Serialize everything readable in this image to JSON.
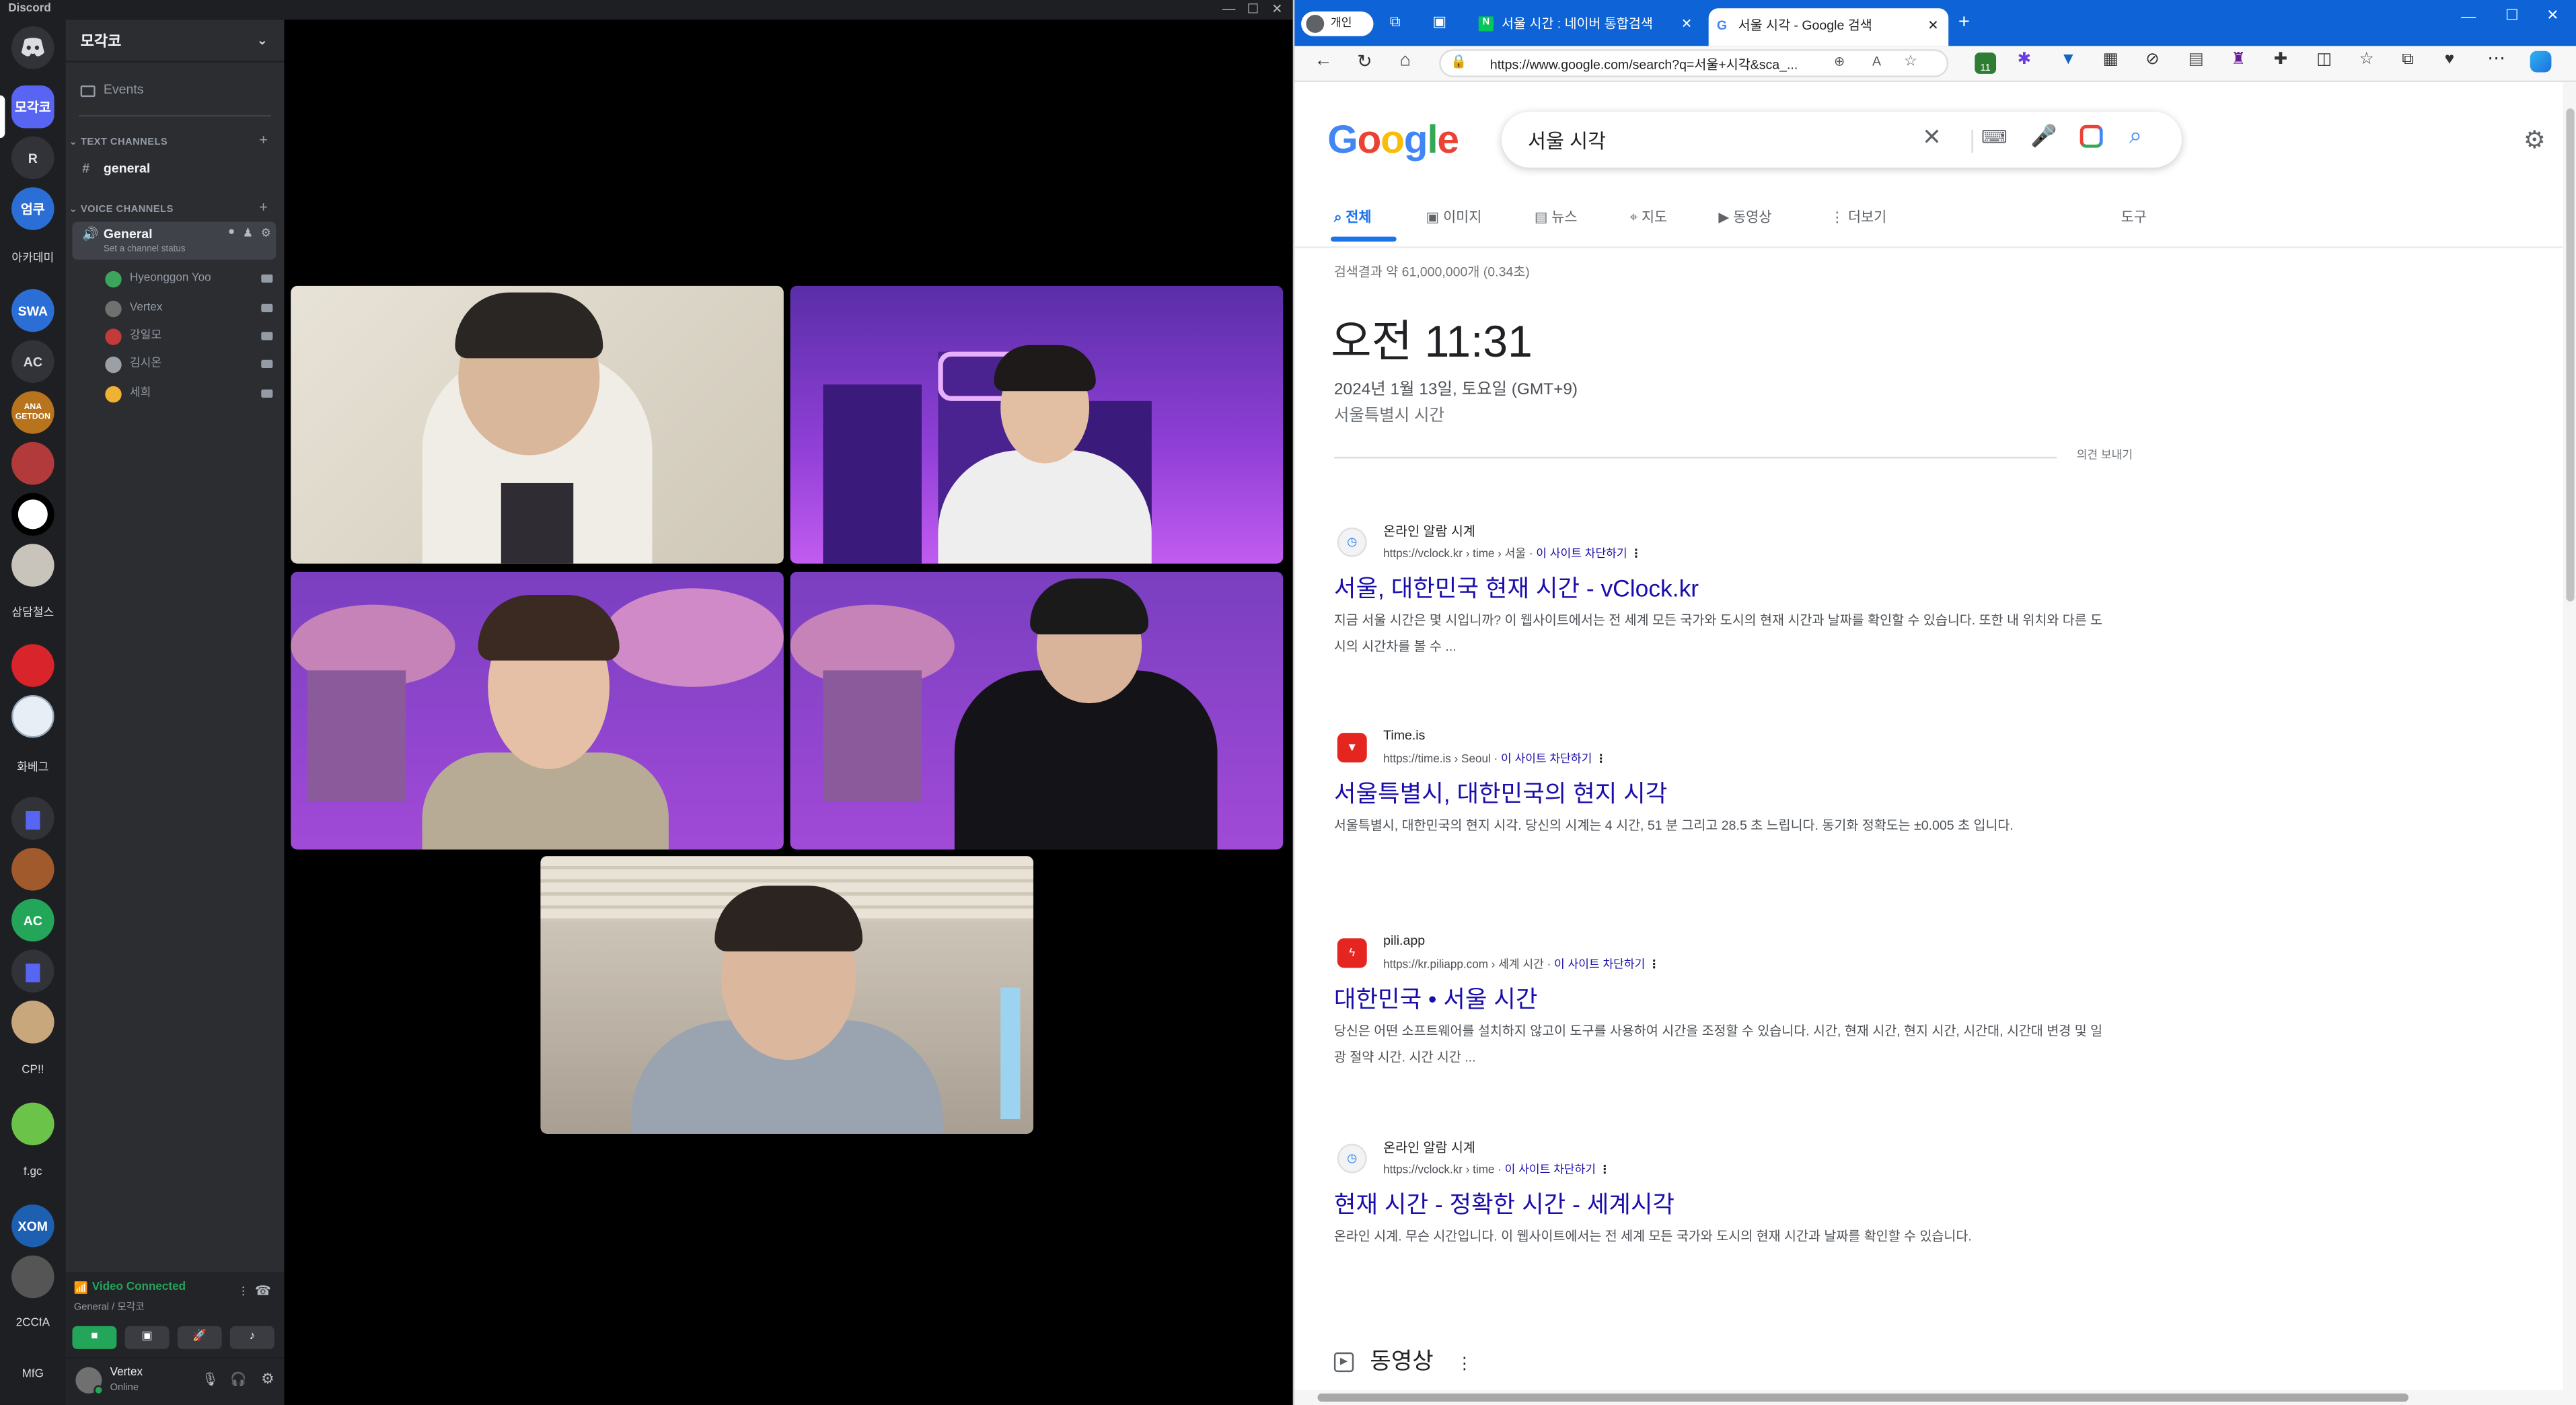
{
  "discord": {
    "app_title": "Discord",
    "server_name": "모각코",
    "events_label": "Events",
    "text_channels_label": "TEXT CHANNELS",
    "general_text": "general",
    "voice_channels_label": "VOICE CHANNELS",
    "voice_channel": "General",
    "channel_status": "Set a channel status",
    "voice_users": [
      "Hyeonggon Yoo",
      "Vertex",
      "강일모",
      "김시온",
      "세희"
    ],
    "rail_servers": [
      "모각코",
      "R",
      "엄쿠",
      "아카데미",
      "SWA",
      "AC",
      "ANA GETDON",
      "",
      "",
      "",
      "삼담철스",
      "",
      "",
      "화베그",
      "",
      "",
      "AC",
      "",
      "",
      "CP!!",
      "",
      "f.gc",
      "XOM",
      "",
      "2CCfA",
      "MfG"
    ],
    "video_connected": "Video Connected",
    "voice_path": "General / 모각코",
    "user_name": "Vertex",
    "user_status": "Online"
  },
  "browser": {
    "profile_label": "개인",
    "tabs": [
      {
        "label": "서울 시간 : 네이버 통합검색",
        "active": false
      },
      {
        "label": "서울 시각 - Google 검색",
        "active": true
      }
    ],
    "url": "https://www.google.com/search?q=서울+시각&sca_...",
    "extension_badge": "11"
  },
  "google": {
    "logo": "Google",
    "query": "서울 시각",
    "tabs": [
      "전체",
      "이미지",
      "뉴스",
      "지도",
      "동영상",
      "더보기"
    ],
    "tools": "도구",
    "result_stats": "검색결과 약 61,000,000개 (0.34초)",
    "time": "오전 11:31",
    "date": "2024년 1월 13일, 토요일 (GMT+9)",
    "location": "서울특별시 시간",
    "feedback": "의견 보내기",
    "results": [
      {
        "site": "온라인 알람 시계",
        "url": "https://vclock.kr › time › 서울",
        "block": "이 사이트 차단하기",
        "title": "서울, 대한민국 현재 시간 - vClock.kr",
        "snippet": "지금 서울 시간은 몇 시입니까? 이 웹사이트에서는 전 세계 모든 국가와 도시의 현재 시간과 날짜를 확인할 수 있습니다. 또한 내 위치와 다른 도시의 시간차를 볼 수 ..."
      },
      {
        "site": "Time.is",
        "url": "https://time.is › Seoul",
        "block": "이 사이트 차단하기",
        "title": "서울특별시, 대한민국의 현지 시각",
        "snippet": "서울특별시, 대한민국의 현지 시각. 당신의 시계는 4 시간, 51 분 그리고 28.5 초 느립니다. 동기화 정확도는 ±0.005 초 입니다."
      },
      {
        "site": "pili.app",
        "url": "https://kr.piliapp.com › 세계 시간",
        "block": "이 사이트 차단하기",
        "title": "대한민국 • 서울 시간",
        "snippet": "당신은 어떤 소프트웨어를 설치하지 않고이 도구를 사용하여 시간을 조정할 수 있습니다. 시간, 현재 시간, 현지 시간, 시간대, 시간대 변경 및 일광 절약 시간. 시간 시간 ..."
      },
      {
        "site": "온라인 알람 시계",
        "url": "https://vclock.kr › time",
        "block": "이 사이트 차단하기",
        "title": "현재 시간 - 정확한 시간 - 세계시각",
        "snippet": "온라인 시계. 무슨 시간입니다. 이 웹사이트에서는 전 세계 모든 국가와 도시의 현재 시간과 날짜를 확인할 수 있습니다."
      }
    ],
    "videos_heading": "동영상"
  }
}
